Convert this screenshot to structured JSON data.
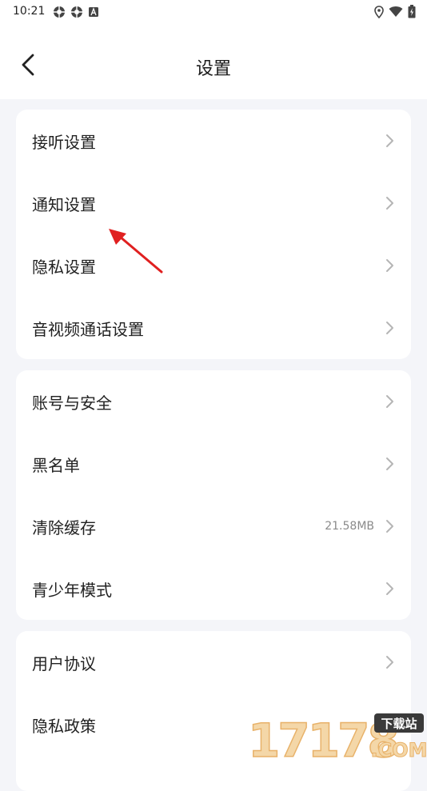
{
  "status_bar": {
    "time": "10:21"
  },
  "header": {
    "title": "设置"
  },
  "groups": [
    {
      "items": [
        {
          "label": "接听设置"
        },
        {
          "label": "通知设置"
        },
        {
          "label": "隐私设置"
        },
        {
          "label": "音视频通话设置"
        }
      ]
    },
    {
      "items": [
        {
          "label": "账号与安全"
        },
        {
          "label": "黑名单"
        },
        {
          "label": "清除缓存",
          "value": "21.58MB"
        },
        {
          "label": "青少年模式"
        }
      ]
    },
    {
      "items": [
        {
          "label": "用户协议"
        },
        {
          "label": "隐私政策"
        }
      ]
    }
  ],
  "watermark": {
    "number": "17178",
    "badge": "下载站",
    "domain": ".COM"
  },
  "colors": {
    "background": "#f4f5f9",
    "card": "#ffffff",
    "chevron": "#b5b5b5",
    "arrow": "#e02020"
  }
}
